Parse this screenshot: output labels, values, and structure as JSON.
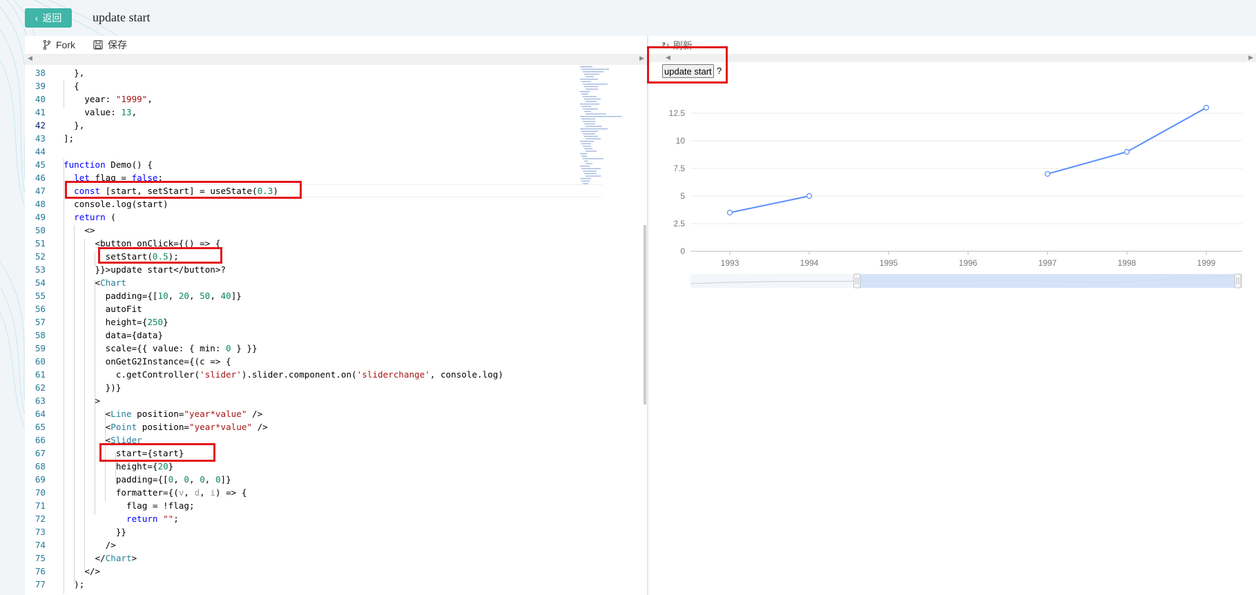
{
  "header": {
    "back_label": "返回",
    "title": "update start"
  },
  "toolbar": {
    "fork_label": "Fork",
    "save_label": "保存"
  },
  "preview": {
    "refresh_label": "刷新",
    "button_label": "update start",
    "after_button": "?"
  },
  "code_lines": [
    {
      "n": "38",
      "html": "  },"
    },
    {
      "n": "39",
      "html": "  {"
    },
    {
      "n": "40",
      "html": "    year: <span class=\"str\">\"1999\"</span>,"
    },
    {
      "n": "41",
      "html": "    value: <span class=\"num\">13</span>,"
    },
    {
      "n": "42",
      "html": "  },"
    },
    {
      "n": "43",
      "html": "];"
    },
    {
      "n": "44",
      "html": ""
    },
    {
      "n": "45",
      "html": "<span class=\"kw\">function</span> Demo() {"
    },
    {
      "n": "46",
      "html": "  <span class=\"kw\">let</span> flag = <span class=\"kw\">false</span>;"
    },
    {
      "n": "47",
      "html": "  <span class=\"kw\">const</span> [start, setStart] = useState(<span class=\"num\">0.3</span>)"
    },
    {
      "n": "48",
      "html": "  console.log(start)"
    },
    {
      "n": "49",
      "html": "  <span class=\"kw\">return</span> ("
    },
    {
      "n": "50",
      "html": "    &lt;&gt;"
    },
    {
      "n": "51",
      "html": "      &lt;button onClick={() =&gt; {"
    },
    {
      "n": "52",
      "html": "        setStart(<span class=\"num\">0.5</span>);"
    },
    {
      "n": "53",
      "html": "      }}&gt;update start&lt;/button&gt;?"
    },
    {
      "n": "54",
      "html": "      &lt;<span class=\"tag\">Chart</span>"
    },
    {
      "n": "55",
      "html": "        padding={[<span class=\"num\">10</span>, <span class=\"num\">20</span>, <span class=\"num\">50</span>, <span class=\"num\">40</span>]}"
    },
    {
      "n": "56",
      "html": "        autoFit"
    },
    {
      "n": "57",
      "html": "        height={<span class=\"num\">250</span>}"
    },
    {
      "n": "58",
      "html": "        data={data}"
    },
    {
      "n": "59",
      "html": "        scale={{ value: { min: <span class=\"num\">0</span> } }}"
    },
    {
      "n": "60",
      "html": "        onGetG2Instance={(c =&gt; {"
    },
    {
      "n": "61",
      "html": "          c.getController(<span class=\"str\">'slider'</span>).slider.component.on(<span class=\"str\">'sliderchange'</span>, console.log)"
    },
    {
      "n": "62",
      "html": "        })}"
    },
    {
      "n": "63",
      "html": "      &gt;"
    },
    {
      "n": "64",
      "html": "        &lt;<span class=\"tag\">Line</span> position=<span class=\"str\">\"year*value\"</span> /&gt;"
    },
    {
      "n": "65",
      "html": "        &lt;<span class=\"tag\">Point</span> position=<span class=\"str\">\"year*value\"</span> /&gt;"
    },
    {
      "n": "66",
      "html": "        &lt;<span class=\"tag\">Slider</span>"
    },
    {
      "n": "67",
      "html": "          start={start}"
    },
    {
      "n": "68",
      "html": "          height={<span class=\"num\">20</span>}"
    },
    {
      "n": "69",
      "html": "          padding={[<span class=\"num\">0</span>, <span class=\"num\">0</span>, <span class=\"num\">0</span>, <span class=\"num\">0</span>]}"
    },
    {
      "n": "70",
      "html": "          formatter={(<span class=\"pl\">v</span>, <span class=\"pl\">d</span>, <span class=\"pl\">i</span>) =&gt; {"
    },
    {
      "n": "71",
      "html": "            flag = !flag;"
    },
    {
      "n": "72",
      "html": "            <span class=\"kw\">return</span> <span class=\"str\">\"\"</span>;"
    },
    {
      "n": "73",
      "html": "          }}"
    },
    {
      "n": "74",
      "html": "        /&gt;"
    },
    {
      "n": "75",
      "html": "      &lt;/<span class=\"tag\">Chart</span>&gt;"
    },
    {
      "n": "76",
      "html": "    &lt;/&gt;"
    },
    {
      "n": "77",
      "html": "  );"
    }
  ],
  "active_line": "42",
  "chart_data": {
    "type": "line",
    "x": [
      "1993",
      "1994",
      "1995",
      "1996",
      "1997",
      "1998",
      "1999"
    ],
    "series": [
      {
        "values": [
          3.5,
          5,
          null,
          null,
          7,
          9,
          13
        ]
      }
    ],
    "y_ticks": [
      "0",
      "2.5",
      "5",
      "7.5",
      "10",
      "12.5"
    ],
    "ylim": [
      0,
      15
    ],
    "grid": true,
    "color": "#5b8ff9",
    "slider": {
      "start": 0.3,
      "end": 1
    }
  }
}
